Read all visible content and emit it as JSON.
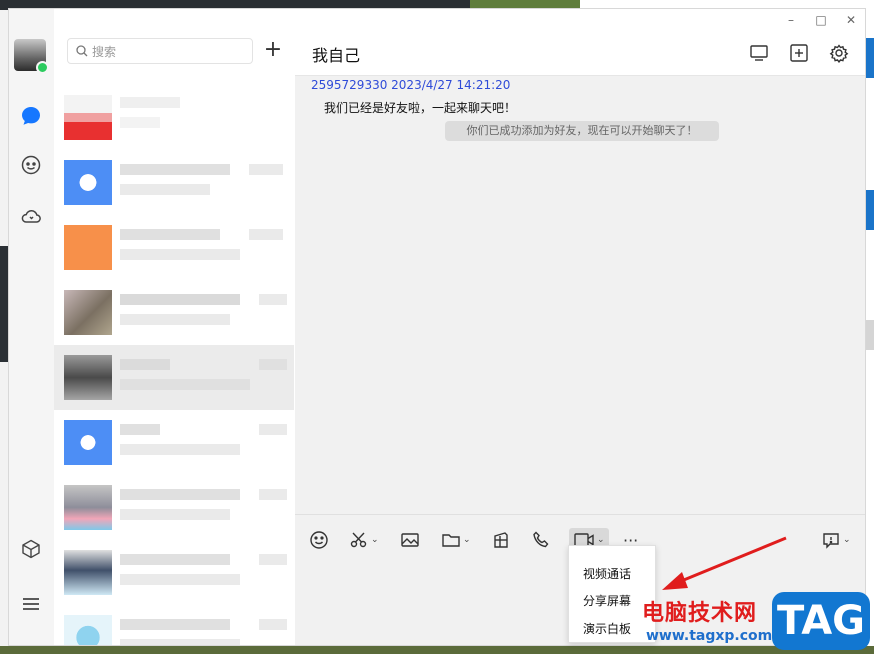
{
  "chat": {
    "title": "我自己",
    "message_meta": "2595729330 2023/4/27 14:21:20",
    "message_text": "我们已经是好友啦，一起来聊天吧！",
    "system_notice": "你们已成功添加为好友，现在可以开始聊天了！"
  },
  "contacts": {
    "search_placeholder": "搜索",
    "add_label": "+"
  },
  "window_controls": {
    "minimize": "–",
    "maximize": "□",
    "close": "✕"
  },
  "toolbar": {
    "more_label": "···"
  },
  "video_menu": {
    "items": [
      {
        "label": "视频通话"
      },
      {
        "label": "分享屏幕"
      },
      {
        "label": "演示白板"
      }
    ]
  },
  "watermark": {
    "site_name": "电脑技术网",
    "url": "www.tagxp.com",
    "tag": "TAG",
    "site_color": "#e01d1d",
    "tag_color": "#1277d1"
  },
  "colors": {
    "accent": "#1677ff",
    "message_meta": "#2f4bd8",
    "online": "#2bcb5e"
  }
}
